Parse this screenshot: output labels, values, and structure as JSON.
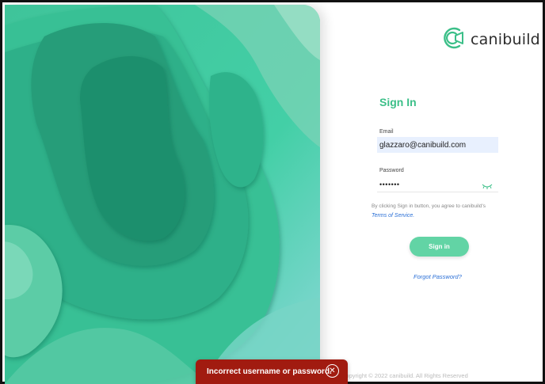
{
  "brand": {
    "name": "canibuild",
    "icon": "canibuild-logo-icon",
    "color": "#3bbf88"
  },
  "form": {
    "title": "Sign In",
    "email_label": "Email",
    "email_value": "glazzaro@canibuild.com",
    "password_label": "Password",
    "password_value": "•••••••",
    "terms_prefix": "By clicking Sign in button, you agree to canibuild's",
    "terms_link": "Terms of Service.",
    "signin_label": "Sign in",
    "forgot_label": "Forgot Password?"
  },
  "footer": {
    "copyright": "Copyright © 2022 canibuild. All Rights Reserved"
  },
  "toast": {
    "message": "Incorrect username or password.",
    "close_icon": "close-icon",
    "color": "#a11b10"
  },
  "colors": {
    "accent": "#3bbf88",
    "button": "#62d4a5",
    "link": "#2a6fd6"
  }
}
